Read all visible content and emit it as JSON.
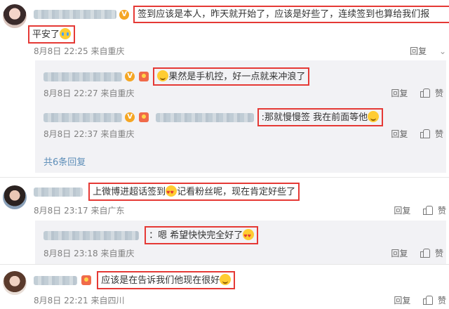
{
  "comments": [
    {
      "text": "签到应该是本人，昨天就开始了，应该是好些了，连续签到也算给我们报",
      "text2": "平安了",
      "meta": "8月8日 22:25 来自重庆",
      "reply_label": "回复",
      "more_icon": "chevron-down-icon",
      "replies": [
        {
          "colon_text": "果然是手机控，好一点就来冲浪了",
          "meta": "8月8日 22:27 来自重庆",
          "reply_label": "回复",
          "like_label": "赞"
        },
        {
          "colon_text": ":那就慢慢签 我在前面等他",
          "meta": "8月8日 22:37 来自重庆",
          "reply_label": "回复",
          "like_label": "赞"
        }
      ],
      "more_replies": "共6条回复"
    },
    {
      "text": "上微博进超话签到",
      "text_tail": "记看粉丝呢，现在肯定好些了",
      "meta": "8月8日 23:17 来自广东",
      "reply_label": "回复",
      "like_label": "赞",
      "replies": [
        {
          "colon_text": "：嗯 希望快快完全好了",
          "meta": "8月8日 23:18 来自重庆",
          "reply_label": "回复",
          "like_label": "赞"
        }
      ]
    },
    {
      "text": "应该是在告诉我们他现在很好",
      "meta": "8月8日 22:21 来自四川",
      "reply_label": "回复",
      "like_label": "赞"
    }
  ],
  "colors": {
    "highlight_border": "#e53935",
    "link": "#5d8eb8",
    "reply_bg": "#f2f2f5"
  }
}
